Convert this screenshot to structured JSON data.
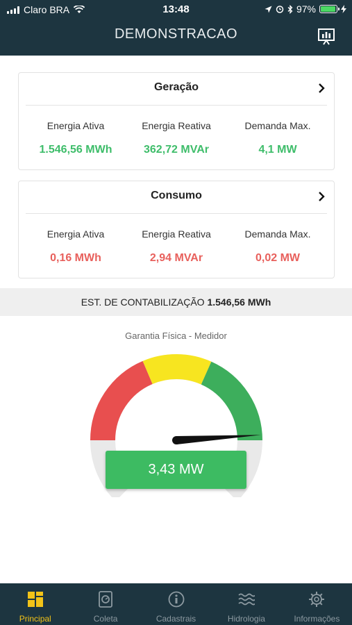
{
  "status_bar": {
    "carrier": "Claro BRA",
    "time": "13:48",
    "battery": "97%",
    "icons": [
      "signal-icon",
      "wifi-icon",
      "location-icon",
      "alarm-icon",
      "bluetooth-icon",
      "battery-icon",
      "charging-icon"
    ]
  },
  "header": {
    "title": "DEMONSTRACAO",
    "chart_button_icon": "presentation-chart-icon"
  },
  "geracao": {
    "title": "Geração",
    "items": [
      {
        "label": "Energia Ativa",
        "value": "1.546,56 MWh"
      },
      {
        "label": "Energia Reativa",
        "value": "362,72 MVAr"
      },
      {
        "label": "Demanda Max.",
        "value": "4,1 MW"
      }
    ]
  },
  "consumo": {
    "title": "Consumo",
    "items": [
      {
        "label": "Energia Ativa",
        "value": "0,16 MWh"
      },
      {
        "label": "Energia Reativa",
        "value": "2,94 MVAr"
      },
      {
        "label": "Demanda Max.",
        "value": "0,02 MW"
      }
    ]
  },
  "contabilizacao": {
    "label": "EST. DE CONTABILIZAÇÃO",
    "value": "1.546,56 MWh"
  },
  "gauge": {
    "label": "Garantia Física - Medidor",
    "value": "3,43 MW",
    "needle_fraction": 0.98,
    "colors": {
      "red": "#e84f4f",
      "yellow": "#f7e520",
      "green": "#3dae5c",
      "track": "#e9e9e9",
      "needle": "#111111"
    }
  },
  "tabbar": {
    "tabs": [
      {
        "label": "Principal",
        "icon": "grid-icon",
        "active": true
      },
      {
        "label": "Coleta",
        "icon": "device-icon",
        "active": false
      },
      {
        "label": "Cadastrais",
        "icon": "info-icon",
        "active": false
      },
      {
        "label": "Hidrologia",
        "icon": "waves-icon",
        "active": false
      },
      {
        "label": "Informações",
        "icon": "gear-icon",
        "active": false
      }
    ]
  },
  "colors": {
    "header_bg": "#1d3540",
    "positive": "#3ebd6a",
    "negative": "#e8605c",
    "active_tab": "#f2c318"
  }
}
